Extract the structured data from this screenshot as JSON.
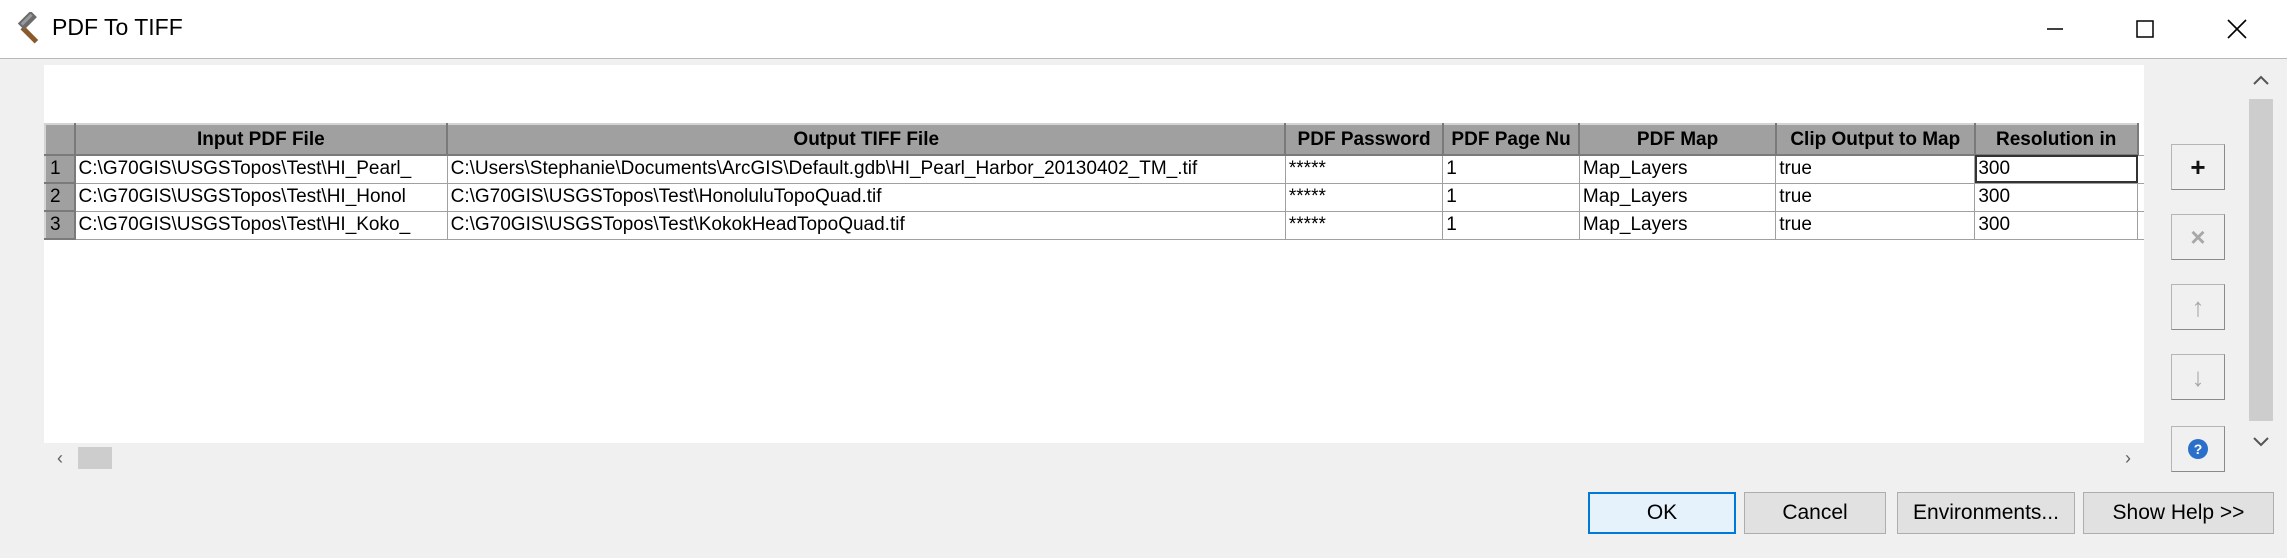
{
  "window": {
    "title": "PDF To TIFF",
    "icon": "hammer-icon",
    "controls": [
      "minimize-icon",
      "maximize-icon",
      "close-icon"
    ]
  },
  "table": {
    "columns": [
      "Input PDF File",
      "Output TIFF File",
      "PDF Password",
      "PDF Page Nu",
      "PDF Map",
      "Clip Output to Map",
      "Resolution in"
    ],
    "rows": [
      {
        "num": "1",
        "cells": [
          "C:\\G70GIS\\USGSTopos\\Test\\HI_Pearl_",
          "C:\\Users\\Stephanie\\Documents\\ArcGIS\\Default.gdb\\HI_Pearl_Harbor_20130402_TM_.tif",
          "*****",
          "1",
          "Map_Layers",
          "true",
          "300"
        ]
      },
      {
        "num": "2",
        "cells": [
          "C:\\G70GIS\\USGSTopos\\Test\\HI_Honol",
          "C:\\G70GIS\\USGSTopos\\Test\\HonoluluTopoQuad.tif",
          "*****",
          "1",
          "Map_Layers",
          "true",
          "300"
        ]
      },
      {
        "num": "3",
        "cells": [
          "C:\\G70GIS\\USGSTopos\\Test\\HI_Koko_",
          "C:\\G70GIS\\USGSTopos\\Test\\KokokHeadTopoQuad.tif",
          "*****",
          "1",
          "Map_Layers",
          "true",
          "300"
        ]
      }
    ]
  },
  "side_buttons": [
    {
      "name": "add-row-button",
      "icon": "plus-icon",
      "glyph": "+",
      "enabled": true
    },
    {
      "name": "delete-row-button",
      "icon": "x-icon",
      "glyph": "×",
      "enabled": false
    },
    {
      "name": "move-up-button",
      "icon": "arrow-up-icon",
      "glyph": "↑",
      "enabled": false
    },
    {
      "name": "move-down-button",
      "icon": "arrow-down-icon",
      "glyph": "↓",
      "enabled": false
    },
    {
      "name": "help-button",
      "icon": "help-icon",
      "glyph": "?",
      "enabled": true
    }
  ],
  "buttons": {
    "ok": "OK",
    "cancel": "Cancel",
    "environments": "Environments...",
    "show_help": "Show Help >>"
  },
  "colors": {
    "accent": "#0078d7",
    "header_bg": "#a0a0a0",
    "dialog_bg": "#f0f0f0"
  }
}
